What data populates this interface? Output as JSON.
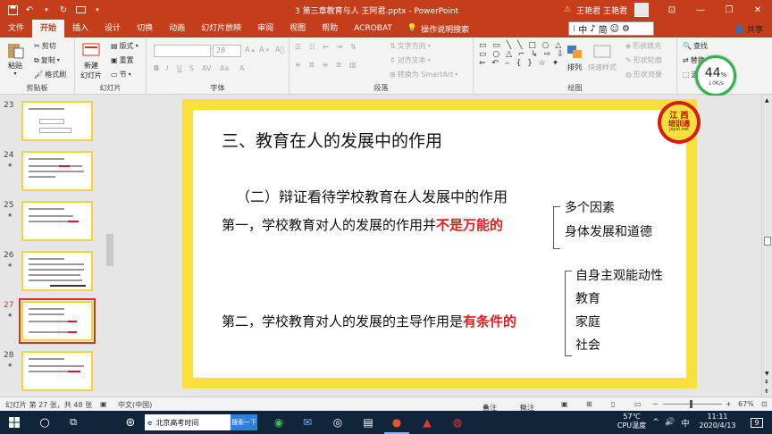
{
  "titlebar": {
    "doc_title": "3 第三章教育与人 王阿君.pptx - PowerPoint",
    "warning_icon": "warning-icon",
    "user": "王艳君 王艳君",
    "minimize": "—",
    "restore": "❐",
    "close": "✕",
    "restore_ribbon": "⊡"
  },
  "tabs": [
    "文件",
    "开始",
    "插入",
    "设计",
    "切换",
    "动画",
    "幻灯片放映",
    "审阅",
    "视图",
    "帮助",
    "ACROBAT"
  ],
  "tell_me": "操作说明搜索",
  "ime": [
    "中",
    "♪",
    "简",
    "☺",
    "⚙"
  ],
  "share": "共享",
  "ribbon": {
    "clipboard": {
      "paste": "粘贴",
      "cut": "剪切",
      "copy": "复制",
      "format_painter": "格式刷",
      "label": "剪贴板"
    },
    "slides": {
      "new_slide": "新建",
      "new_slide2": "幻灯片",
      "layout": "版式",
      "reset": "重置",
      "section": "节",
      "label": "幻灯片"
    },
    "font": {
      "size": "28",
      "label": "字体",
      "bold": "B",
      "italic": "I",
      "underline": "U",
      "strike": "S",
      "spacing": "AV",
      "case": "Aa",
      "color": "A"
    },
    "paragraph": {
      "text_direction": "文字方向",
      "align_text": "对齐文本",
      "smartart": "转换为 SmartArt",
      "label": "段落"
    },
    "drawing": {
      "arrange": "排列",
      "quick_styles": "快速样式",
      "fill": "形状填充",
      "outline": "形状轮廓",
      "effects": "形状效果",
      "label": "绘图"
    },
    "editing": {
      "find": "查找",
      "replace": "替换",
      "select": "选择"
    }
  },
  "network": {
    "percent": "44",
    "unit": "%",
    "speed": "0K/s"
  },
  "thumbnails": [
    {
      "num": "23",
      "star": false,
      "selected": false
    },
    {
      "num": "24",
      "star": true,
      "selected": false
    },
    {
      "num": "25",
      "star": true,
      "selected": false
    },
    {
      "num": "26",
      "star": true,
      "selected": false
    },
    {
      "num": "27",
      "star": true,
      "selected": true
    },
    {
      "num": "28",
      "star": true,
      "selected": false
    }
  ],
  "slide": {
    "title": "三、教育在人的发展中的作用",
    "subtitle": "（二）辩证看待学校教育在人发展中的作用",
    "p1_prefix": "第一，学校教育对人的发展的作用并",
    "p1_red": "不是万能的",
    "p1_items": [
      "多个因素",
      "身体发展和道德"
    ],
    "p2_prefix": "第二，学校教育对人的发展的主导作用是",
    "p2_red": "有条件的",
    "p2_items": [
      "自身主观能动性",
      "教育",
      "家庭",
      "社会"
    ],
    "logo": {
      "line1": "江 西",
      "line2": "培训通",
      "line3": "jxpxt.net"
    }
  },
  "status": {
    "slide_count": "幻灯片 第 27 张，共 48 张",
    "language": "中文(中国)",
    "notes": "备注",
    "comments": "批注",
    "zoom": "67%"
  },
  "taskbar": {
    "search_text": "北京高考时间",
    "search_btn": "搜索一下",
    "temp": "57℃",
    "temp_label": "CPU温度",
    "ime": "中",
    "time": "11:11",
    "date": "2020/4/13",
    "notif": "9"
  }
}
